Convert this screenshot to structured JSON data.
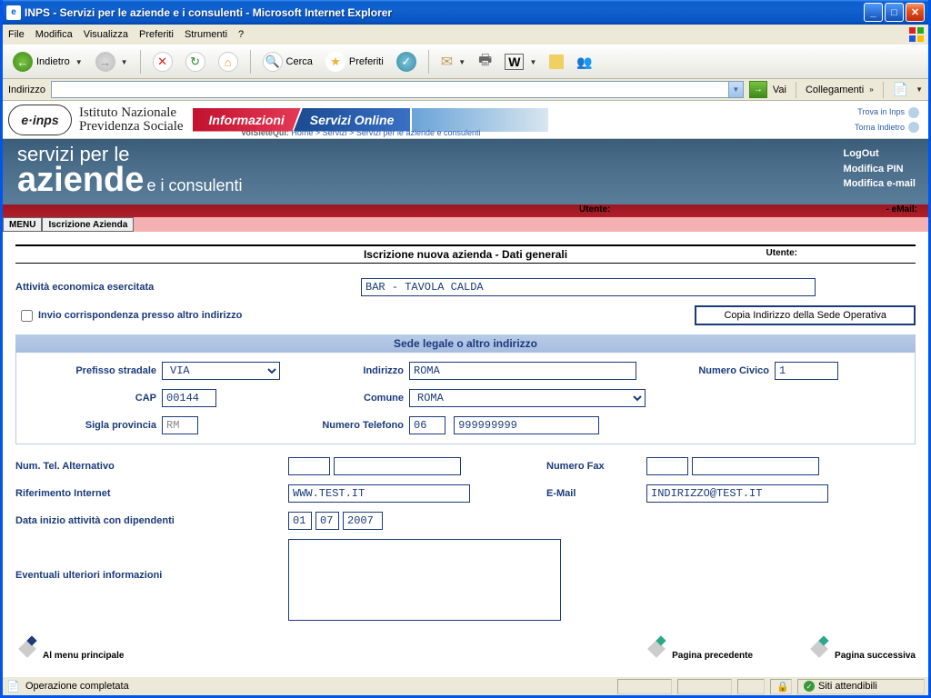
{
  "window": {
    "title": "INPS - Servizi per le aziende e i consulenti - Microsoft Internet Explorer"
  },
  "menubar": [
    "File",
    "Modifica",
    "Visualizza",
    "Preferiti",
    "Strumenti",
    "?"
  ],
  "toolbar": {
    "back": "Indietro",
    "search": "Cerca",
    "fav": "Preferiti"
  },
  "addressbar": {
    "label": "Indirizzo",
    "go": "Vai",
    "links": "Collegamenti"
  },
  "inps": {
    "logo": "e·inps",
    "inst1": "Istituto Nazionale",
    "inst2": "Previdenza Sociale",
    "tab_info": "Informazioni",
    "tab_serv": "Servizi Online",
    "crumb_label": "VoiSieteQui:",
    "crumb1": "Home",
    "crumb2": "Servizi",
    "crumb3": "Servizi per le aziende e consulenti",
    "link_trova": "Trova in Inps",
    "link_torna": "Torna Indietro"
  },
  "banner": {
    "line1": "servizi per le",
    "line2": "aziende",
    "line3": "e i consulenti",
    "logout": "LogOut",
    "modpin": "Modifica PIN",
    "modemail": "Modifica e-mail"
  },
  "redbar": {
    "utente": "Utente:",
    "email": "- eMail:"
  },
  "tabs": {
    "menu": "MENU",
    "iscr": "Iscrizione Azienda"
  },
  "form": {
    "title": "Iscrizione nuova azienda - Dati generali",
    "utente": "Utente:",
    "attivita_label": "Attività economica esercitata",
    "attivita_value": "BAR - TAVOLA CALDA",
    "invio_corr": "Invio corrispondenza presso altro indirizzo",
    "btn_copia": "Copia Indirizzo della Sede Operativa",
    "section": "Sede legale o altro indirizzo",
    "prefisso_label": "Prefisso stradale",
    "prefisso_value": "VIA",
    "indirizzo_label": "Indirizzo",
    "indirizzo_value": "ROMA",
    "civico_label": "Numero Civico",
    "civico_value": "1",
    "cap_label": "CAP",
    "cap_value": "00144",
    "comune_label": "Comune",
    "comune_value": "ROMA",
    "sigla_label": "Sigla provincia",
    "sigla_value": "RM",
    "tel_label": "Numero Telefono",
    "tel_pref": "06",
    "tel_num": "999999999",
    "telalt_label": "Num. Tel. Alternativo",
    "fax_label": "Numero Fax",
    "rif_label": "Riferimento Internet",
    "rif_value": "WWW.TEST.IT",
    "email_label": "E-Mail",
    "email_value": "INDIRIZZO@TEST.IT",
    "data_label": "Data inizio attività con dipendenti",
    "data_d": "01",
    "data_m": "07",
    "data_y": "2007",
    "note_label": "Eventuali ulteriori informazioni",
    "nav_menu": "Al menu principale",
    "nav_prev": "Pagina precedente",
    "nav_next": "Pagina  successiva"
  },
  "status": {
    "text": "Operazione completata",
    "zone": "Siti attendibili"
  }
}
